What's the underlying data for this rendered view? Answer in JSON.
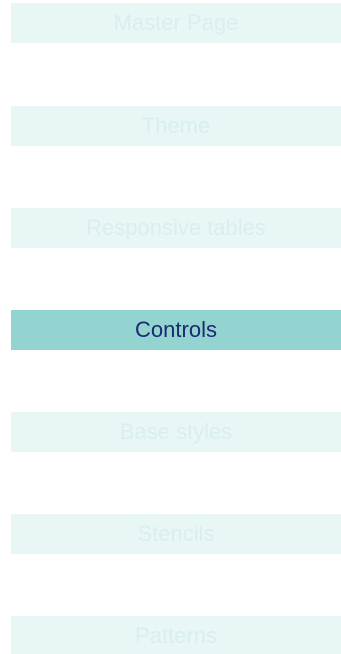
{
  "nav": {
    "items": [
      {
        "label": "Master Page",
        "active": false
      },
      {
        "label": "Theme",
        "active": false
      },
      {
        "label": "Responsive tables",
        "active": false
      },
      {
        "label": "Controls",
        "active": true
      },
      {
        "label": "Base styles",
        "active": false
      },
      {
        "label": "Stencils",
        "active": false
      },
      {
        "label": "Patterns",
        "active": false
      }
    ]
  },
  "colors": {
    "item_background": "#e9f6f6",
    "item_text": "#d9eef0",
    "active_background": "#93d4d1",
    "active_text": "#1a2a6e"
  }
}
